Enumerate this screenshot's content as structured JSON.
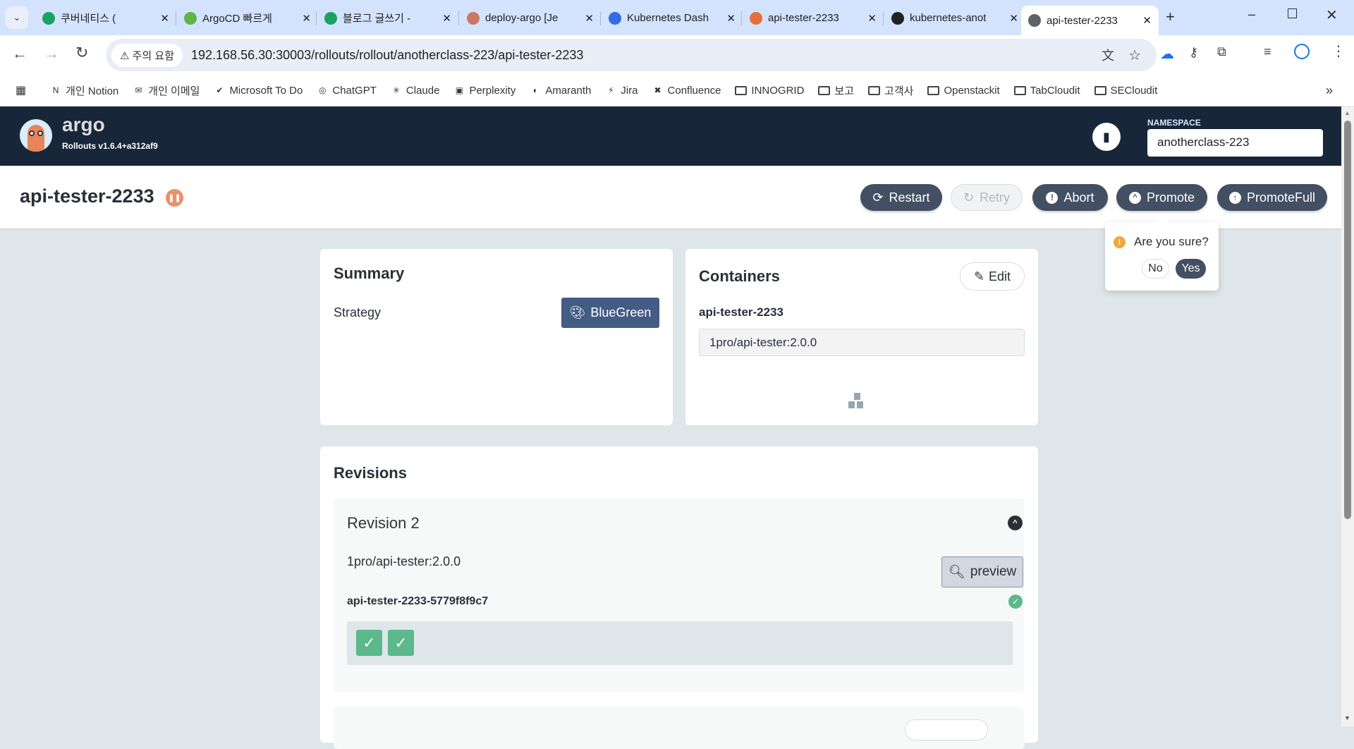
{
  "browser": {
    "tabs": [
      {
        "title": "쿠버네티스 (",
        "icon": "#1aa260"
      },
      {
        "title": "ArgoCD 빠르게",
        "icon": "#5fb443"
      },
      {
        "title": "블로그 글쓰기 -",
        "icon": "#1aa260"
      },
      {
        "title": "deploy-argo [Je",
        "icon": "#c76"
      },
      {
        "title": "Kubernetes Dash",
        "icon": "#326ce5"
      },
      {
        "title": "api-tester-2233",
        "icon": "#e96d3b"
      },
      {
        "title": "kubernetes-anot",
        "icon": "#222"
      },
      {
        "title": "api-tester-2233",
        "icon": "#5f6368"
      }
    ],
    "warning": "주의 요함",
    "url": "192.168.56.30:30003/rollouts/rollout/anotherclass-223/api-tester-2233",
    "bookmarks": [
      "개인 Notion",
      "개인 이메일",
      "Microsoft To Do",
      "ChatGPT",
      "Claude",
      "Perplexity",
      "Amaranth",
      "Jira",
      "Confluence",
      "INNOGRID",
      "보고",
      "고객사",
      "Openstackit",
      "TabCloudit",
      "SECloudit"
    ]
  },
  "header": {
    "logo_text": "argo",
    "version": "Rollouts v1.6.4+a312af9",
    "namespace_label": "NAMESPACE",
    "namespace_value": "anotherclass-223"
  },
  "rollout": {
    "name": "api-tester-2233",
    "actions": {
      "restart": "Restart",
      "retry": "Retry",
      "abort": "Abort",
      "promote": "Promote",
      "promote_full": "PromoteFull"
    },
    "confirm": {
      "question": "Are you sure?",
      "no": "No",
      "yes": "Yes"
    }
  },
  "summary": {
    "title": "Summary",
    "strategy_label": "Strategy",
    "strategy_value": "BlueGreen"
  },
  "containers": {
    "title": "Containers",
    "edit": "Edit",
    "container_name": "api-tester-2233",
    "image": "1pro/api-tester:2.0.0"
  },
  "revisions": {
    "title": "Revisions",
    "items": [
      {
        "title": "Revision 2",
        "image": "1pro/api-tester:2.0.0",
        "preview": "preview",
        "replicaset": "api-tester-2233-5779f8f9c7",
        "pods": [
          "healthy",
          "healthy"
        ]
      }
    ]
  },
  "colors": {
    "header": "#18263a",
    "button": "#434f63",
    "strategy": "#445b84",
    "success": "#5bb98c",
    "paused": "#e8916a",
    "warning": "#f1a73a"
  }
}
